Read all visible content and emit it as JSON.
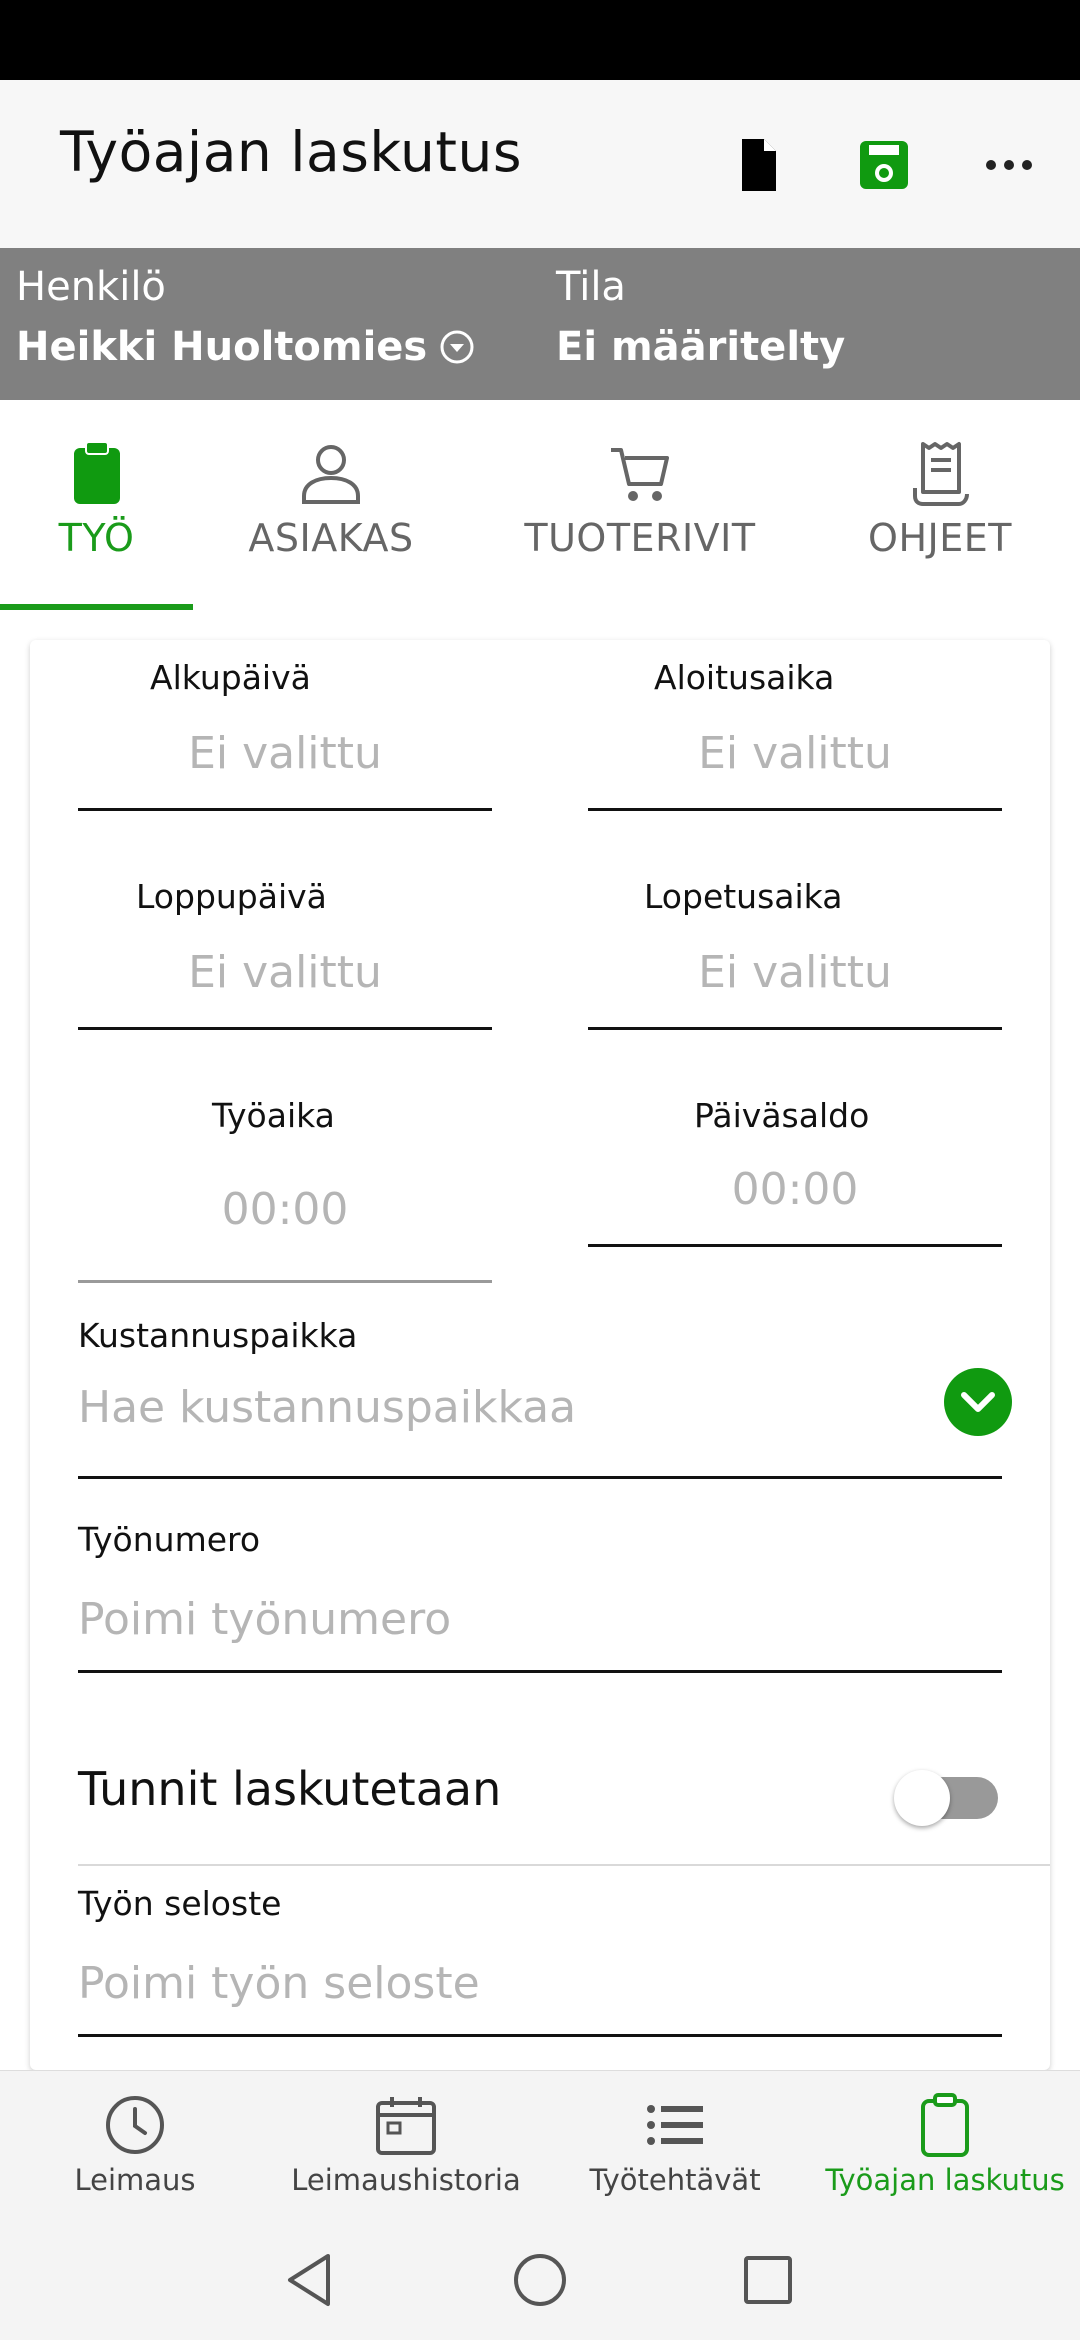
{
  "app": {
    "title": "Työajan laskutus"
  },
  "header": {
    "actions": [
      {
        "icon": "document-icon",
        "color": "#000000"
      },
      {
        "icon": "save-icon",
        "color": "#109a10"
      },
      {
        "icon": "more-icon",
        "color": "#222222"
      }
    ]
  },
  "info": {
    "person_label": "Henkilö",
    "person_value": "Heikki Huoltomies",
    "state_label": "Tila",
    "state_value": "Ei määritelty"
  },
  "tabs": [
    {
      "label": "TYÖ",
      "icon": "clipboard-icon",
      "active": true
    },
    {
      "label": "ASIAKAS",
      "icon": "person-icon",
      "active": false
    },
    {
      "label": "TUOTERIVIT",
      "icon": "cart-icon",
      "active": false
    },
    {
      "label": "OHJEET",
      "icon": "receipt-icon",
      "active": false
    }
  ],
  "form": {
    "start_date": {
      "label": "Alkupäivä",
      "value": "Ei valittu"
    },
    "start_time": {
      "label": "Aloitusaika",
      "value": "Ei valittu"
    },
    "end_date": {
      "label": "Loppupäivä",
      "value": "Ei valittu"
    },
    "end_time": {
      "label": "Lopetusaika",
      "value": "Ei valittu"
    },
    "work_time": {
      "label": "Työaika",
      "value": "00:00"
    },
    "day_balance": {
      "label": "Päiväsaldo",
      "value": "00:00"
    },
    "cost_center": {
      "label": "Kustannuspaikka",
      "placeholder": "Hae kustannuspaikkaa"
    },
    "work_number": {
      "label": "Työnumero",
      "placeholder": "Poimi työnumero"
    },
    "billable": {
      "label": "Tunnit laskutetaan",
      "checked": false
    },
    "description": {
      "label": "Työn seloste",
      "placeholder": "Poimi työn seloste"
    }
  },
  "bottom_nav": [
    {
      "label": "Leimaus",
      "icon": "clock-icon",
      "active": false
    },
    {
      "label": "Leimaushistoria",
      "icon": "calendar-icon",
      "active": false
    },
    {
      "label": "Työtehtävät",
      "icon": "list-icon",
      "active": false
    },
    {
      "label": "Työajan laskutus",
      "icon": "clipboard-icon",
      "active": true
    }
  ],
  "colors": {
    "accent": "#1a9b1a",
    "band": "#808080",
    "placeholder": "#b5b5b5"
  }
}
